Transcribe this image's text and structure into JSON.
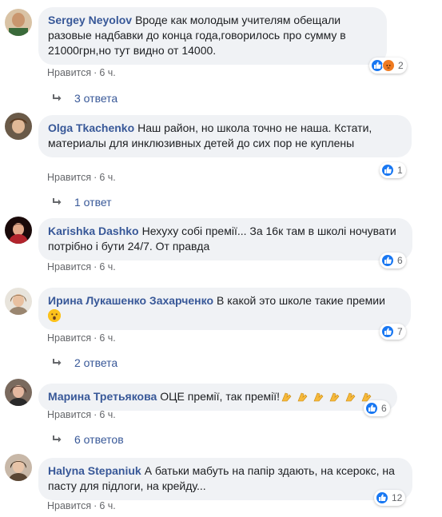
{
  "comments": [
    {
      "author": "Sergey Neyolov",
      "text": "Вроде как молодым учителям обещали разовые надбавки до конца года,говорилось про сумму в 21000грн,но тут видно от 14000.",
      "like_label": "Нравится",
      "time": "6 ч.",
      "reaction_count": "2",
      "reactions": [
        "like-icon",
        "angry-icon"
      ],
      "replies": "3 ответа",
      "avatar_color": "#c9a27a"
    },
    {
      "author": "Olga Tkachenko",
      "text": "Наш район, но школа точно не наша. Кстати, материалы для инклюзивных детей до сих пор не куплены",
      "like_label": "Нравится",
      "time": "6 ч.",
      "reaction_count": "1",
      "reactions": [
        "like-icon"
      ],
      "replies": "1 ответ",
      "avatar_color": "#8a6b4a"
    },
    {
      "author": "Karishka Dashko",
      "text": "Нехуху собі премії... За 16к там в школі ночувати потрібно і бути 24/7. От правда",
      "like_label": "Нравится",
      "time": "6 ч.",
      "reaction_count": "6",
      "reactions": [
        "like-icon"
      ],
      "avatar_color": "#b2242c"
    },
    {
      "author": "Ирина Лукашенко Захарченко",
      "text": "В какой это школе такие премии",
      "like_label": "Нравится",
      "time": "6 ч.",
      "reaction_count": "7",
      "reactions": [
        "like-icon"
      ],
      "replies": "2 ответа",
      "avatar_color": "#a08c6e"
    },
    {
      "author": "Марина Третьякова",
      "text": "ОЦЕ премії, так премії!",
      "like_label": "Нравится",
      "time": "6 ч.",
      "reaction_count": "6",
      "reactions": [
        "like-icon"
      ],
      "replies": "6 ответов",
      "avatar_color": "#6b4a3a"
    },
    {
      "author": "Halyna Stepaniuk",
      "text": "А батьки мабуть на папір здають, на ксерокс, на пасту для підлоги, на крейду...",
      "like_label": "Нравится",
      "time": "6 ч.",
      "reaction_count": "12",
      "reactions": [
        "like-icon"
      ],
      "avatar_color": "#5a4634"
    }
  ],
  "colors": {
    "author": "#385898",
    "bubble": "#f0f2f5",
    "like_blue": "#1877f2",
    "angry_orange": "#f07b21"
  }
}
